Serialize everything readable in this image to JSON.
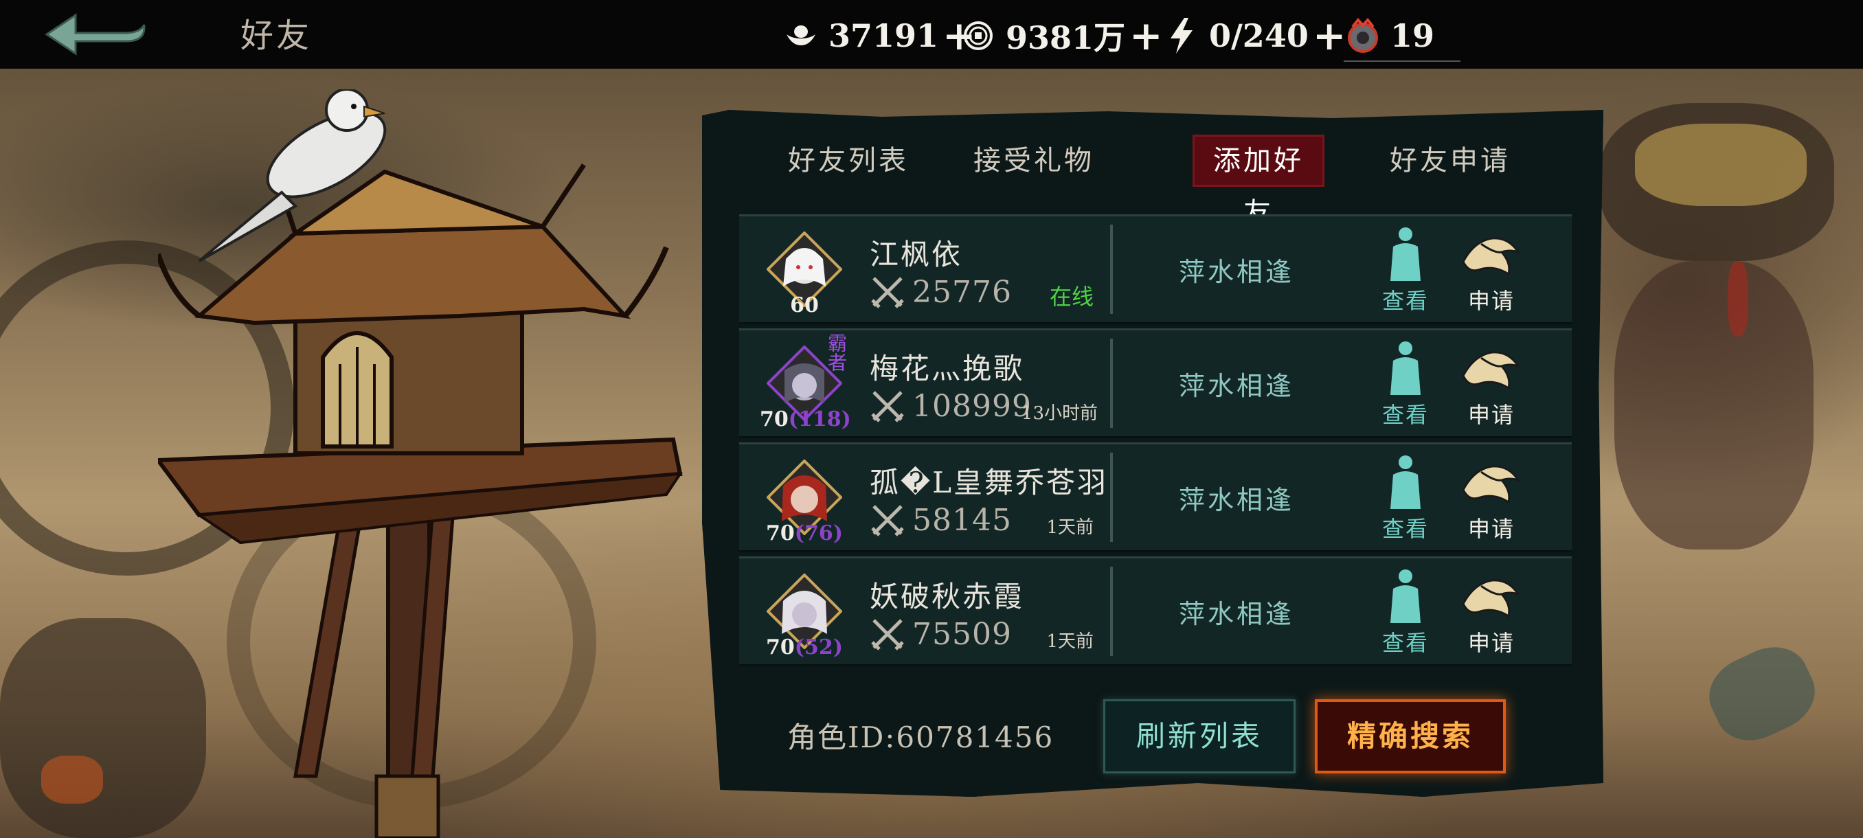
{
  "header": {
    "title": "好友",
    "resources": [
      {
        "icon": "silver-ingot-icon",
        "value": "37191",
        "plus": "+"
      },
      {
        "icon": "coin-icon",
        "value": "9381万",
        "plus": "+"
      },
      {
        "icon": "lightning-icon",
        "value": "0/240",
        "plus": "+"
      },
      {
        "icon": "badge-icon",
        "value": "19",
        "plus": ""
      }
    ]
  },
  "tabs": [
    {
      "label": "好友列表",
      "active": false
    },
    {
      "label": "接受礼物",
      "active": false
    },
    {
      "label": "添加好友",
      "active": true
    },
    {
      "label": "好友申请",
      "active": false
    }
  ],
  "players": [
    {
      "name": "江枫依",
      "level": "60",
      "level_extra": "",
      "power": "25776",
      "status": "在线",
      "online": true,
      "relation": "萍水相逢",
      "view_label": "查看",
      "apply_label": "申请",
      "badge": ""
    },
    {
      "name": "梅花灬挽歌",
      "level": "70",
      "level_extra": "(118)",
      "power": "108999",
      "status": "13小时前",
      "online": false,
      "relation": "萍水相逢",
      "view_label": "查看",
      "apply_label": "申请",
      "badge": "霸者"
    },
    {
      "name": "孤�L皇舞乔苍羽",
      "level": "70",
      "level_extra": "(76)",
      "power": "58145",
      "status": "1天前",
      "online": false,
      "relation": "萍水相逢",
      "view_label": "查看",
      "apply_label": "申请",
      "badge": ""
    },
    {
      "name": "妖破秋赤霞",
      "level": "70",
      "level_extra": "(52)",
      "power": "75509",
      "status": "1天前",
      "online": false,
      "relation": "萍水相逢",
      "view_label": "查看",
      "apply_label": "申请",
      "badge": ""
    }
  ],
  "footer": {
    "role_id": "角色ID:60781456",
    "refresh_label": "刷新列表",
    "search_label": "精确搜索"
  },
  "colors": {
    "tab_active_bg": "#5a0b12",
    "online_green": "#4fd245",
    "relation_teal": "#8fc8c2",
    "search_orange": "#e05a14"
  }
}
